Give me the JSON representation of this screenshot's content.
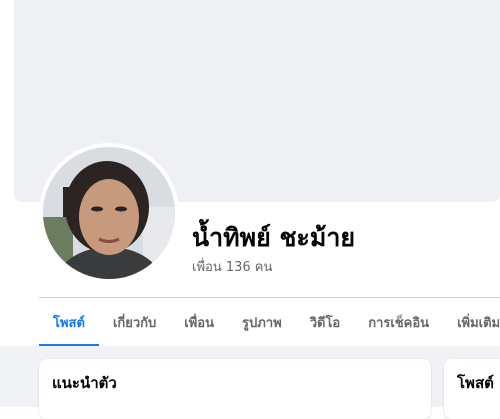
{
  "profile": {
    "name": "น้ำทิพย์ ชะม้าย",
    "friends": "เพื่อน 136 คน"
  },
  "tabs": [
    {
      "label": "โพสต์",
      "active": true
    },
    {
      "label": "เกี่ยวกับ",
      "active": false
    },
    {
      "label": "เพื่อน",
      "active": false
    },
    {
      "label": "รูปภาพ",
      "active": false
    },
    {
      "label": "วิดีโอ",
      "active": false
    },
    {
      "label": "การเช็คอิน",
      "active": false
    },
    {
      "label": "เพิ่มเติม",
      "active": false
    }
  ],
  "cards": {
    "intro_title": "แนะนำตัว",
    "posts_title": "โพสต์"
  },
  "colors": {
    "accent": "#1877f2",
    "cover": "#eff0f4",
    "page_bg": "#f0f2f5"
  }
}
